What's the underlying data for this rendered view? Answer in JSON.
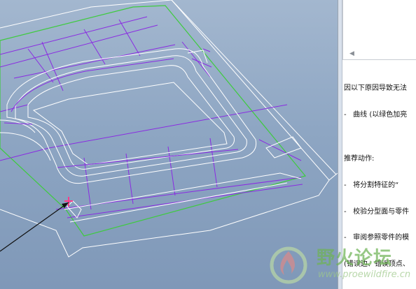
{
  "viewport": {
    "background_color": "#8fa7c4",
    "wire_colors": {
      "model": "#ffffff",
      "sketch": "#8a2be2",
      "boundary": "#3ecb3e",
      "datum": "#ff3b8a"
    }
  },
  "sidebar": {
    "list_scroll_icon": "scroll-left-arrow",
    "message_lines": [
      "因以下原因导致无法",
      "-   曲线 (以绿色加亮",
      "",
      "推荐动作:",
      "-   将分割特征的“",
      "-   校验分型面与零件",
      "-   审阅参照零件的模",
      "(错误边、错误顶点、"
    ]
  },
  "watermark": {
    "title": "野火论坛",
    "url": "www.proewildfire.cn",
    "color": "#6fb356"
  }
}
